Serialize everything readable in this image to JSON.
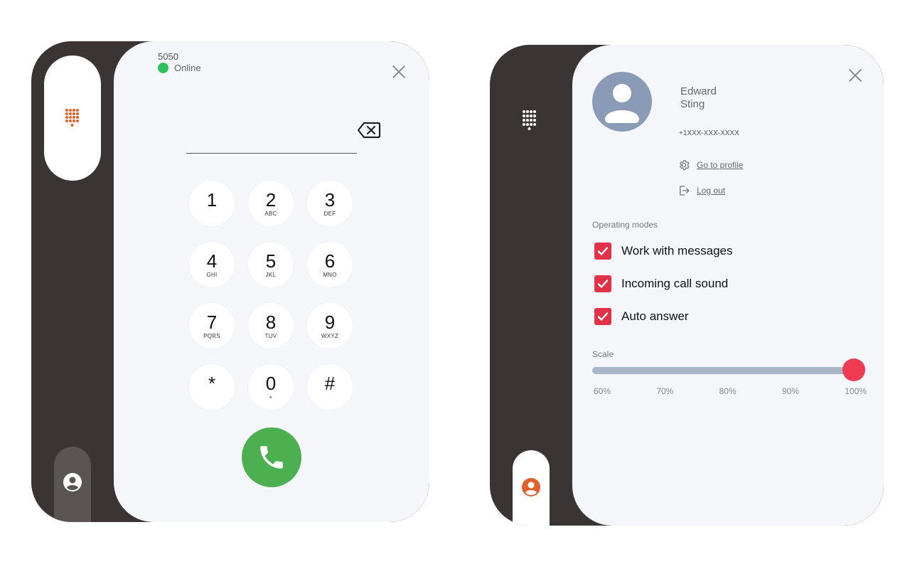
{
  "dialer": {
    "extension": "5050",
    "status": "Online",
    "number_value": "",
    "keys": [
      {
        "digit": "1",
        "letters": ""
      },
      {
        "digit": "2",
        "letters": "ABC"
      },
      {
        "digit": "3",
        "letters": "DEF"
      },
      {
        "digit": "4",
        "letters": "GHI"
      },
      {
        "digit": "5",
        "letters": "JKL"
      },
      {
        "digit": "6",
        "letters": "MNO"
      },
      {
        "digit": "7",
        "letters": "PQRS"
      },
      {
        "digit": "8",
        "letters": "TUV"
      },
      {
        "digit": "9",
        "letters": "WXYZ"
      },
      {
        "digit": "*",
        "letters": ""
      },
      {
        "digit": "0",
        "letters": "+"
      },
      {
        "digit": "#",
        "letters": ""
      }
    ]
  },
  "profile": {
    "first_name": "Edward",
    "last_name": "Sting",
    "phone": "+1XXX-XXX-XXXX",
    "go_to_profile": "Go to profile",
    "log_out": "Log out",
    "operating_modes_label": "Operating modes",
    "modes": [
      {
        "label": "Work with messages",
        "checked": true
      },
      {
        "label": "Incoming call sound",
        "checked": true
      },
      {
        "label": "Auto answer",
        "checked": true
      }
    ],
    "scale_label": "Scale",
    "scale_value": "100%",
    "scale_options": [
      "60%",
      "70%",
      "80%",
      "90%",
      "100%"
    ]
  },
  "colors": {
    "rail": "#3a3534",
    "panel": "#f5f6fa",
    "accent_orange": "#e0602e",
    "online": "#2ec25f",
    "call": "#4caf50",
    "checkbox": "#e03349",
    "slider_thumb": "#ee3b52",
    "slider_track": "#a9b6c7",
    "avatar": "#8a9bb8"
  },
  "icons": {
    "keypad": "keypad-icon",
    "user": "user-icon",
    "close": "close-icon",
    "backspace": "backspace-icon",
    "call": "phone-icon",
    "settings": "gear-icon",
    "logout": "logout-icon",
    "check": "check-icon"
  }
}
